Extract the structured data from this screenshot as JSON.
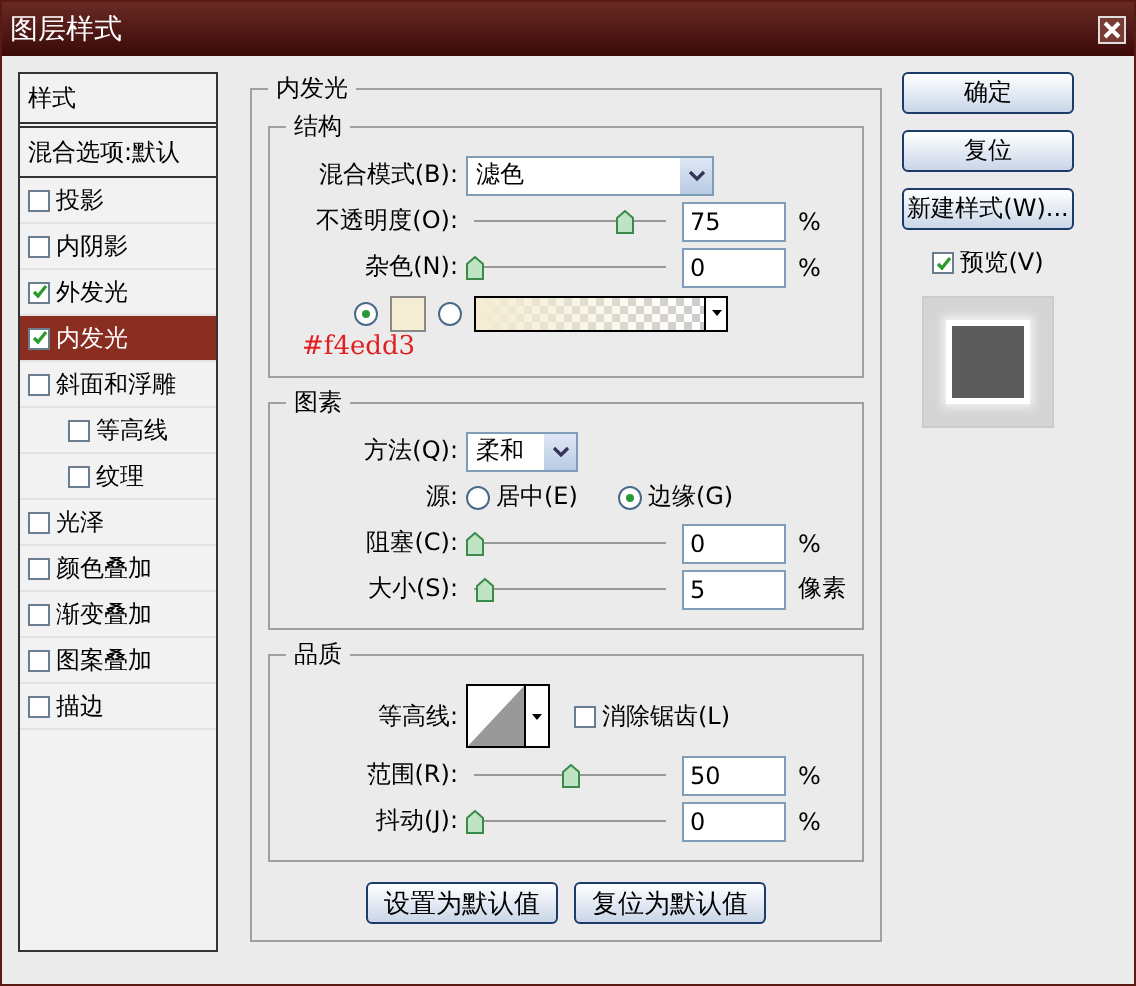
{
  "window": {
    "title": "图层样式"
  },
  "sidebar": {
    "header": "样式",
    "items": [
      {
        "kind": "heading",
        "label": "混合选项:默认",
        "selected": false
      },
      {
        "kind": "check",
        "label": "投影",
        "checked": false,
        "selected": false
      },
      {
        "kind": "check",
        "label": "内阴影",
        "checked": false,
        "selected": false
      },
      {
        "kind": "check",
        "label": "外发光",
        "checked": true,
        "selected": false
      },
      {
        "kind": "check",
        "label": "内发光",
        "checked": true,
        "selected": true
      },
      {
        "kind": "check",
        "label": "斜面和浮雕",
        "checked": false,
        "selected": false,
        "children": [
          {
            "kind": "check",
            "label": "等高线",
            "checked": false,
            "selected": false
          },
          {
            "kind": "check",
            "label": "纹理",
            "checked": false,
            "selected": false
          }
        ]
      },
      {
        "kind": "check",
        "label": "光泽",
        "checked": false,
        "selected": false
      },
      {
        "kind": "check",
        "label": "颜色叠加",
        "checked": false,
        "selected": false
      },
      {
        "kind": "check",
        "label": "渐变叠加",
        "checked": false,
        "selected": false
      },
      {
        "kind": "check",
        "label": "图案叠加",
        "checked": false,
        "selected": false
      },
      {
        "kind": "check",
        "label": "描边",
        "checked": false,
        "selected": false
      }
    ]
  },
  "panel": {
    "title": "内发光",
    "structure": {
      "title": "结构",
      "blend_mode": {
        "label": "混合模式(B):",
        "value": "滤色"
      },
      "sliders": [
        {
          "label": "不透明度(O):",
          "level": 0.78,
          "value": "75",
          "unit": "%"
        },
        {
          "label": "杂色(N):",
          "level": 0,
          "value": "0",
          "unit": "%"
        }
      ],
      "fill_options": [
        {
          "kind": "color",
          "selected": true,
          "color": "#f4edd3"
        },
        {
          "kind": "gradient",
          "selected": false,
          "color": "#f4edd3"
        }
      ],
      "annotation": "#f4edd3"
    },
    "elements": {
      "title": "图素",
      "technique": {
        "label": "方法(Q):",
        "value": "柔和"
      },
      "source": {
        "label": "源:",
        "options": [
          {
            "label": "居中(E)",
            "selected": false
          },
          {
            "label": "边缘(G)",
            "selected": true
          }
        ]
      },
      "sliders": [
        {
          "label": "阻塞(C):",
          "level": 0,
          "value": "0",
          "unit": "%"
        },
        {
          "label": "大小(S):",
          "level": 0.05,
          "value": "5",
          "unit": "像素"
        }
      ]
    },
    "quality": {
      "title": "品质",
      "contour_label": "等高线:",
      "anti_alias": {
        "label": "消除锯齿(L)",
        "checked": false
      },
      "sliders": [
        {
          "label": "范围(R):",
          "level": 0.5,
          "value": "50",
          "unit": "%"
        },
        {
          "label": "抖动(J):",
          "level": 0,
          "value": "0",
          "unit": "%"
        }
      ]
    },
    "buttons": [
      "设置为默认值",
      "复位为默认值"
    ]
  },
  "actions": {
    "buttons": [
      "确定",
      "复位",
      "新建样式(W)..."
    ],
    "preview": {
      "label": "预览(V)",
      "checked": true
    }
  }
}
